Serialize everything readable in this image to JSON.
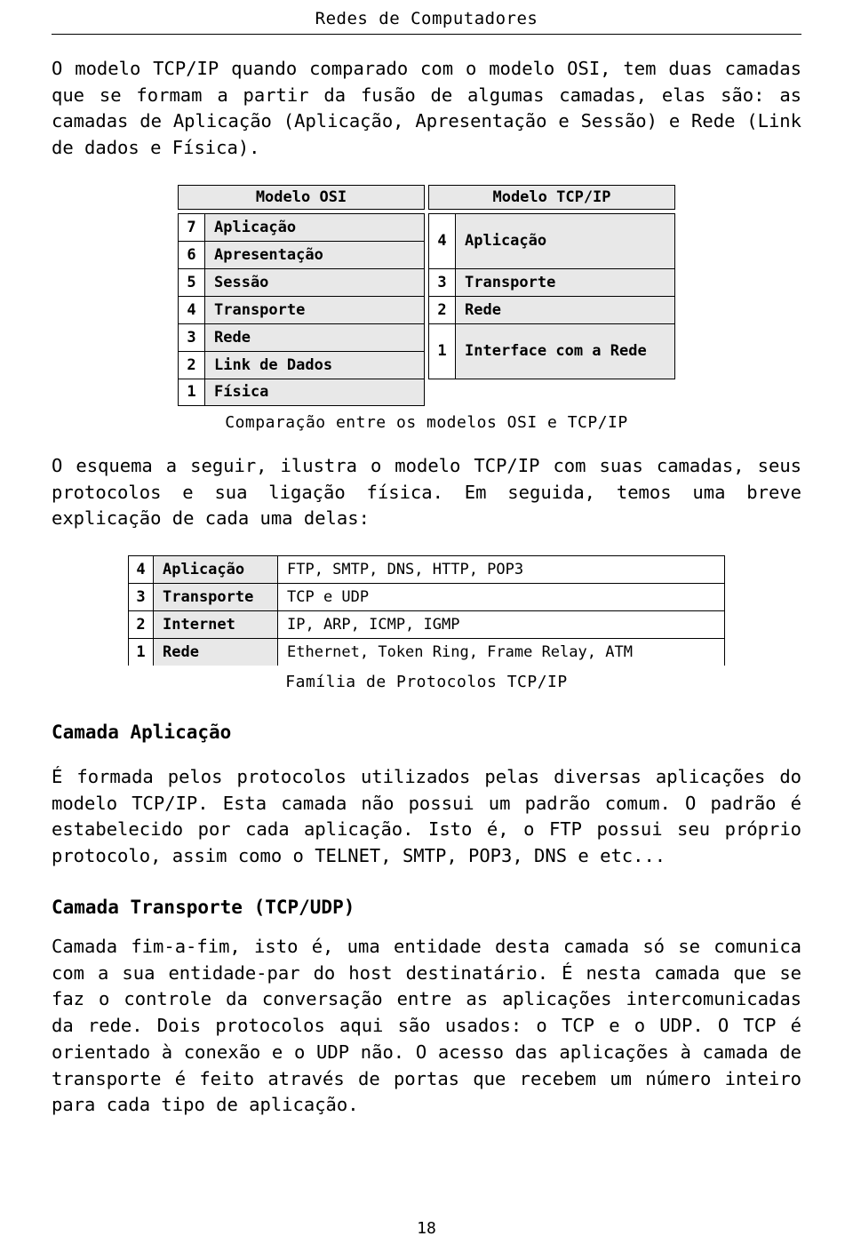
{
  "header": {
    "title": "Redes de Computadores"
  },
  "intro_paragraph": "O modelo TCP/IP quando comparado com o modelo OSI, tem duas camadas que se formam a partir da fusão de algumas camadas, elas são: as camadas de Aplicação (Aplicação, Apresentação e Sessão) e Rede (Link de dados e Física).",
  "comparison_table": {
    "head_left": "Modelo OSI",
    "head_right": "Modelo TCP/IP",
    "osi_layers": [
      {
        "num": "7",
        "name": "Aplicação"
      },
      {
        "num": "6",
        "name": "Apresentação"
      },
      {
        "num": "5",
        "name": "Sessão"
      },
      {
        "num": "4",
        "name": "Transporte"
      },
      {
        "num": "3",
        "name": "Rede"
      },
      {
        "num": "2",
        "name": "Link de Dados"
      },
      {
        "num": "1",
        "name": "Física"
      }
    ],
    "tcpip_layers": [
      {
        "num": "4",
        "name": "Aplicação"
      },
      {
        "num": "3",
        "name": "Transporte"
      },
      {
        "num": "2",
        "name": "Rede"
      },
      {
        "num": "1",
        "name": "Interface com a Rede"
      }
    ],
    "caption": "Comparação entre os modelos OSI e TCP/IP"
  },
  "mid_paragraph": "O esquema a seguir, ilustra o modelo TCP/IP com suas camadas, seus protocolos e sua ligação física. Em seguida, temos uma breve explicação de cada uma delas:",
  "protocol_table": {
    "rows": [
      {
        "num": "4",
        "layer": "Aplicação",
        "protocols": "FTP, SMTP, DNS, HTTP, POP3"
      },
      {
        "num": "3",
        "layer": "Transporte",
        "protocols": "TCP e UDP"
      },
      {
        "num": "2",
        "layer": "Internet",
        "protocols": "IP, ARP, ICMP, IGMP"
      },
      {
        "num": "1",
        "layer": "Rede",
        "protocols": "Ethernet, Token Ring, Frame Relay, ATM"
      }
    ],
    "caption": "Família de Protocolos TCP/IP"
  },
  "sections": [
    {
      "heading": "Camada Aplicação",
      "text": "É formada pelos protocolos utilizados pelas diversas aplicações do modelo TCP/IP. Esta camada não possui um padrão comum. O padrão é estabelecido por cada aplicação. Isto é, o FTP possui seu próprio protocolo, assim como o TELNET, SMTP, POP3, DNS e etc..."
    },
    {
      "heading": "Camada Transporte (TCP/UDP)",
      "text": "Camada fim-a-fim, isto é, uma entidade desta camada só se comunica com a sua entidade-par do host destinatário. É nesta camada que se faz o controle da conversação entre as aplicações intercomunicadas da rede. Dois protocolos aqui são usados: o TCP e o UDP. O TCP é orientado à conexão e o UDP não. O acesso das aplicações à camada de transporte é feito através de portas que recebem um número inteiro para cada tipo de aplicação."
    }
  ],
  "page_number": "18"
}
